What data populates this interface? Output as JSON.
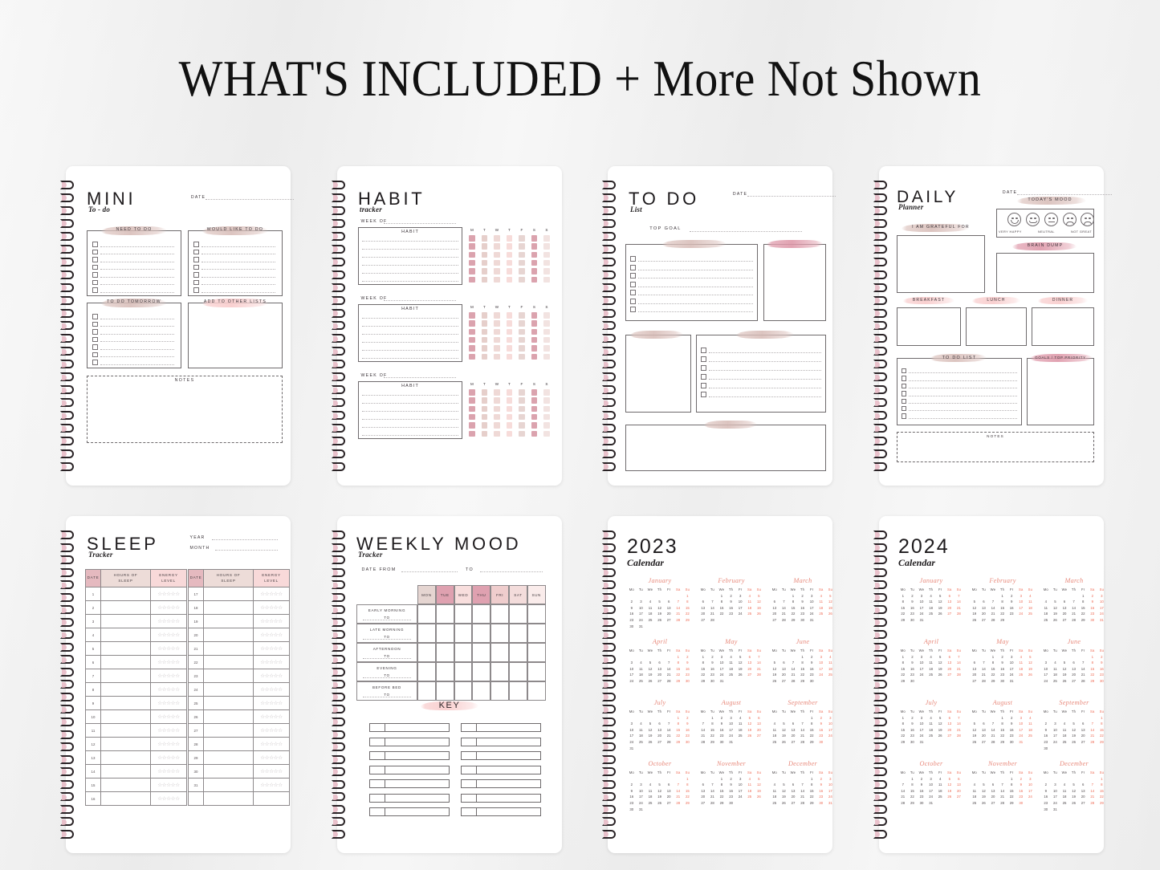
{
  "title": {
    "main": "WHAT'S INCLUDED",
    "suffix": "+ More Not Shown"
  },
  "pages": [
    {
      "id": "mini-to-do",
      "heading": "MINI",
      "subheading": "To - do",
      "date_label": "DATE",
      "boxes": [
        {
          "label": "NEED TO DO",
          "type": "checklist",
          "rows": 7
        },
        {
          "label": "WOULD LIKE TO DO",
          "type": "checklist",
          "rows": 7
        },
        {
          "label": "TO DO TOMORROW",
          "type": "checklist",
          "rows": 7
        },
        {
          "label": "ADD TO OTHER LISTS",
          "type": "blank"
        },
        {
          "label": "NOTES",
          "type": "dashed-blank"
        }
      ]
    },
    {
      "id": "habit-tracker",
      "heading": "HABIT",
      "subheading": "tracker",
      "week_label": "WEEK OF",
      "habit_label": "HABIT",
      "day_headers": [
        "M",
        "T",
        "W",
        "T",
        "F",
        "S",
        "S"
      ],
      "week_count": 3,
      "grid_rows": 6,
      "day_colors": [
        "#dba3ae",
        "#e6cfcb",
        "#efd9d6",
        "#f7dcda",
        "#e7d5d2",
        "#dba3ae",
        "#f2e3e1"
      ]
    },
    {
      "id": "to-do-list",
      "heading": "TO DO",
      "subheading": "List",
      "date_label": "DATE",
      "top_goal_label": "TOP GOAL",
      "sections": [
        {
          "label": "",
          "type": "checklist",
          "rows": 7
        },
        {
          "label": "",
          "type": "blank"
        },
        {
          "label": "",
          "type": "blank"
        },
        {
          "label": "",
          "type": "checklist",
          "rows": 6
        },
        {
          "label": "",
          "type": "blank"
        }
      ]
    },
    {
      "id": "daily-planner",
      "heading": "DAILY",
      "subheading": "Planner",
      "date_label": "DATE",
      "mood_label": "TODAY'S MOOD",
      "mood_scale": [
        "VERY HAPPY",
        "NEUTRAL",
        "NOT GREAT"
      ],
      "mood_faces": [
        "very-happy",
        "happy",
        "neutral",
        "sad",
        "very-sad"
      ],
      "grateful_label": "I AM GRATEFUL FOR",
      "brain_dump_label": "BRAIN DUMP",
      "meals": [
        "BREAKFAST",
        "LUNCH",
        "DINNER"
      ],
      "todo_label": "TO DO LIST",
      "todo_rows": 7,
      "goals_label": "GOALS / TOP PRIORITY",
      "notes_label": "NOTES"
    },
    {
      "id": "sleep-tracker",
      "heading": "SLEEP",
      "subheading": "Tracker",
      "year_label": "YEAR",
      "month_label": "MONTH",
      "columns": [
        "DATE",
        "HOURS OF SLEEP",
        "ENERGY LEVEL"
      ],
      "left_dates": [
        1,
        2,
        3,
        4,
        5,
        6,
        7,
        8,
        9,
        10,
        11,
        12,
        13,
        14,
        15,
        16
      ],
      "right_dates": [
        17,
        18,
        19,
        20,
        21,
        22,
        23,
        24,
        25,
        26,
        27,
        28,
        29,
        30,
        31,
        ""
      ],
      "stars_per_row": 5,
      "star_glyph": "☆"
    },
    {
      "id": "weekly-mood",
      "heading": "WEEKLY MOOD",
      "subheading": "Tracker",
      "date_from_label": "DATE FROM",
      "date_to_label": "TO",
      "days": [
        "MON",
        "TUE",
        "WED",
        "THU",
        "FRI",
        "SAT",
        "SUN"
      ],
      "day_header_colors": [
        "#e5d5d1",
        "#dfa1b0",
        "#f8dedd",
        "#dfa1b0",
        "#efcdcd",
        "#f3dcdb",
        "#faeceb"
      ],
      "time_rows": [
        "EARLY MORNING",
        "LATE MORNING",
        "AFTERNOON",
        "EVENING",
        "BEFORE BED"
      ],
      "row_to_label": "TO",
      "key_label": "KEY",
      "key_rows": 7,
      "key_columns": 2
    },
    {
      "id": "calendar-2023",
      "heading": "2023",
      "subheading": "Calendar",
      "dow": [
        "Mo",
        "Tu",
        "We",
        "Th",
        "Fr",
        "Sa",
        "Su"
      ],
      "months": [
        {
          "name": "January",
          "start": 6,
          "days": 31
        },
        {
          "name": "February",
          "start": 2,
          "days": 28
        },
        {
          "name": "March",
          "start": 2,
          "days": 31
        },
        {
          "name": "April",
          "start": 5,
          "days": 30
        },
        {
          "name": "May",
          "start": 0,
          "days": 31
        },
        {
          "name": "June",
          "start": 3,
          "days": 30
        },
        {
          "name": "July",
          "start": 5,
          "days": 31
        },
        {
          "name": "August",
          "start": 1,
          "days": 31
        },
        {
          "name": "September",
          "start": 4,
          "days": 30
        },
        {
          "name": "October",
          "start": 6,
          "days": 31
        },
        {
          "name": "November",
          "start": 2,
          "days": 30
        },
        {
          "name": "December",
          "start": 4,
          "days": 31
        }
      ]
    },
    {
      "id": "calendar-2024",
      "heading": "2024",
      "subheading": "Calendar",
      "dow": [
        "Mo",
        "Tu",
        "We",
        "Th",
        "Fr",
        "Sa",
        "Su"
      ],
      "months": [
        {
          "name": "January",
          "start": 0,
          "days": 31
        },
        {
          "name": "February",
          "start": 3,
          "days": 29
        },
        {
          "name": "March",
          "start": 4,
          "days": 31
        },
        {
          "name": "April",
          "start": 0,
          "days": 30
        },
        {
          "name": "May",
          "start": 2,
          "days": 31
        },
        {
          "name": "June",
          "start": 5,
          "days": 30
        },
        {
          "name": "July",
          "start": 0,
          "days": 31
        },
        {
          "name": "August",
          "start": 3,
          "days": 31
        },
        {
          "name": "September",
          "start": 6,
          "days": 30
        },
        {
          "name": "October",
          "start": 1,
          "days": 31
        },
        {
          "name": "November",
          "start": 4,
          "days": 30
        },
        {
          "name": "December",
          "start": 6,
          "days": 31
        }
      ]
    }
  ],
  "colors": {
    "background": "#ededed",
    "page": "#ffffff",
    "ink": "#3a3338",
    "rule": "#6e6a6c",
    "highlight_taupe": "#d6bab5",
    "highlight_rose": "#dd96a7",
    "highlight_pale": "#f8cbcb",
    "calendar_accent": "#e8897b",
    "calendar_weekend": "#ef6a54",
    "spiral_ring": "#2a2326",
    "spiral_pink": "#e8b9c4"
  }
}
